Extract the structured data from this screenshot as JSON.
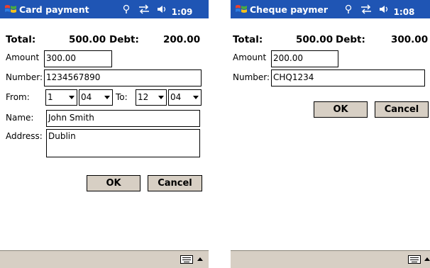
{
  "card_screen": {
    "title": "Card payment",
    "time": "1:09",
    "total_label": "Total:",
    "total_value": "500.00",
    "debt_label": "Debt:",
    "debt_value": "200.00",
    "amount_label": "Amount",
    "amount_value": "300.00",
    "number_label": "Number:",
    "number_value": "1234567890",
    "from_label": "From:",
    "from_day": "1",
    "from_month": "04",
    "to_label": "To:",
    "to_day": "12",
    "to_month": "04",
    "name_label": "Name:",
    "name_value": "John Smith",
    "address_label": "Address:",
    "address_value": "Dublin",
    "ok_label": "OK",
    "cancel_label": "Cancel"
  },
  "cheque_screen": {
    "title": "Cheque paymer",
    "time": "1:08",
    "total_label": "Total:",
    "total_value": "500.00",
    "debt_label": "Debt:",
    "debt_value": "300.00",
    "amount_label": "Amount",
    "amount_value": "200.00",
    "number_label": "Number:",
    "number_value": "CHQ1234",
    "ok_label": "OK",
    "cancel_label": "Cancel"
  },
  "colors": {
    "titlebar": "#1f55b4",
    "button_face": "#d7cfc4",
    "bottombar": "#d7cfc4"
  },
  "icons": [
    "windows-start-icon",
    "antenna-icon",
    "sync-icon",
    "speaker-icon",
    "keyboard-icon",
    "up-arrow-icon"
  ]
}
